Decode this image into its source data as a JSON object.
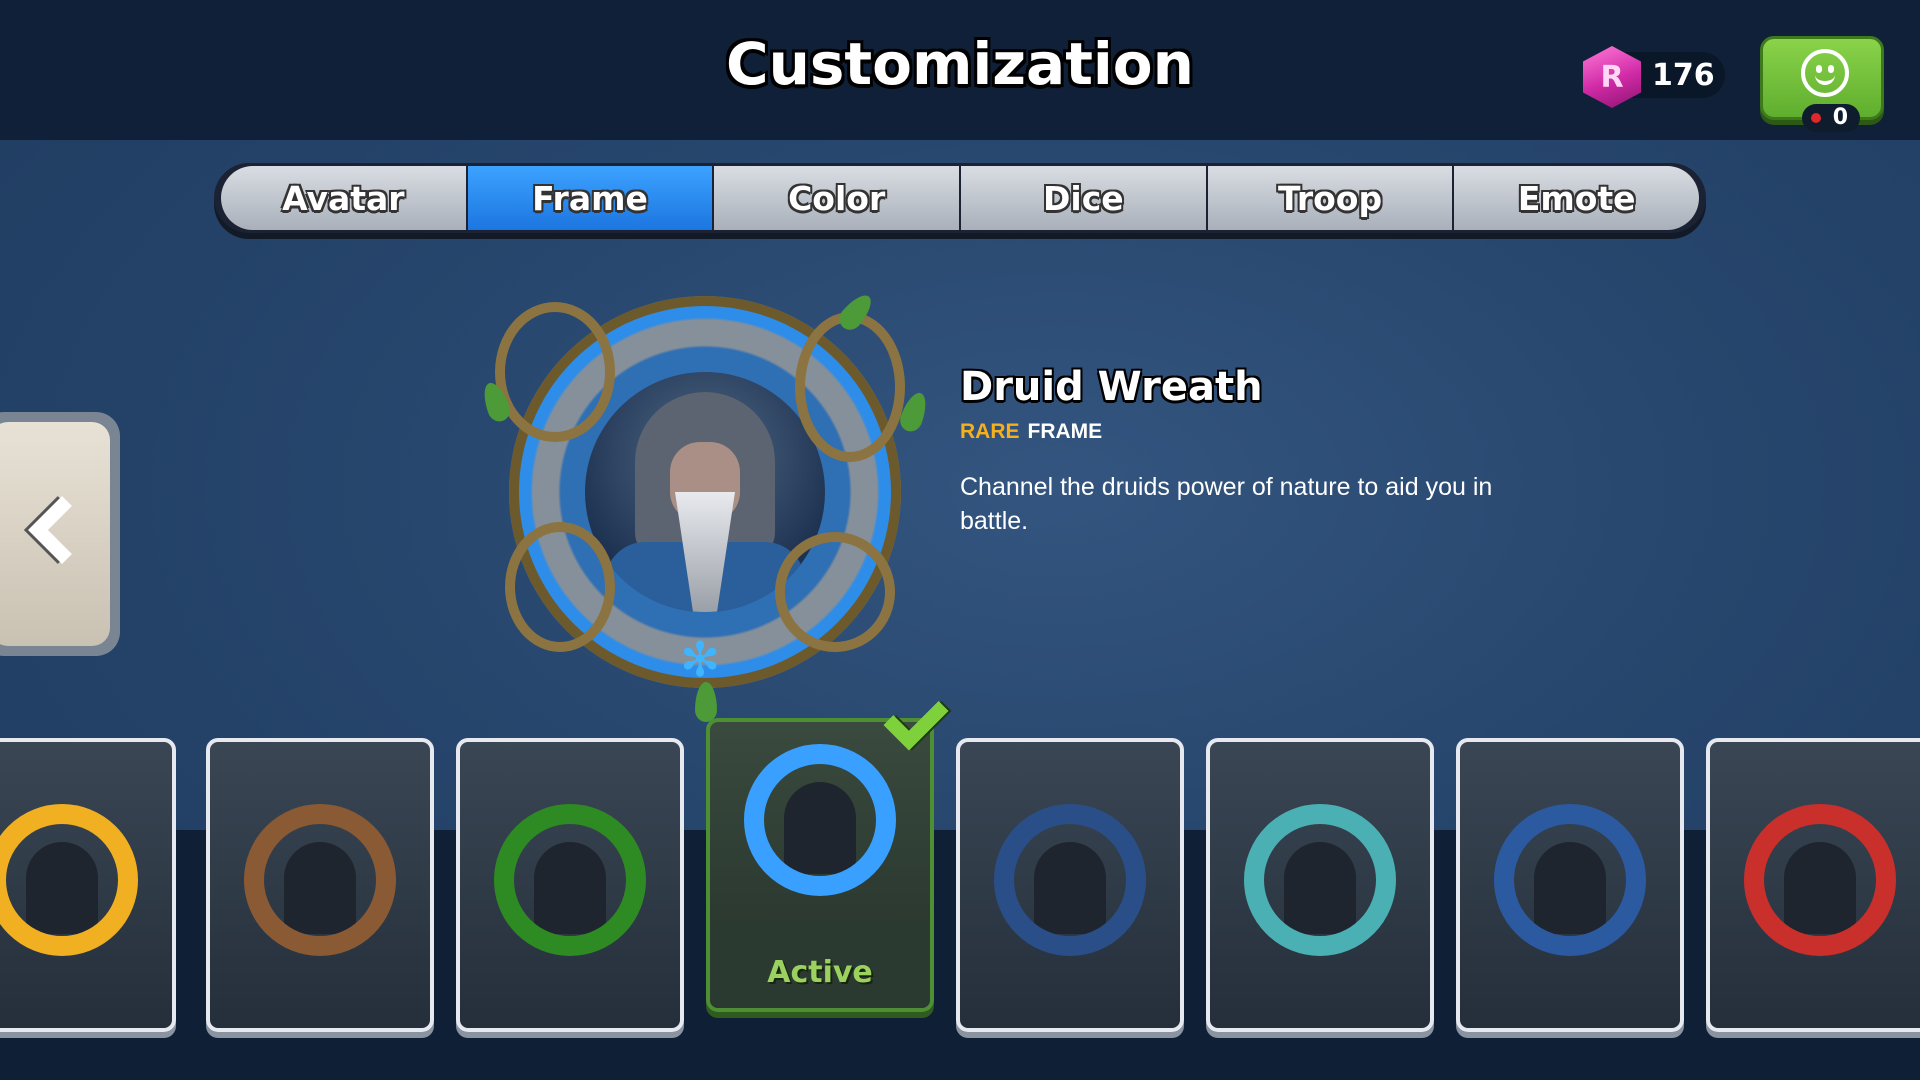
{
  "header": {
    "title": "Customization",
    "currency_icon": "R",
    "currency_count": "176",
    "emote_count": "0"
  },
  "tabs": [
    {
      "label": "Avatar",
      "active": false
    },
    {
      "label": "Frame",
      "active": true
    },
    {
      "label": "Color",
      "active": false
    },
    {
      "label": "Dice",
      "active": false
    },
    {
      "label": "Troop",
      "active": false
    },
    {
      "label": "Emote",
      "active": false
    }
  ],
  "detail": {
    "name": "Druid Wreath",
    "rarity": "RARE",
    "type": "FRAME",
    "description": "Channel the druids power of nature to aid you in battle."
  },
  "frames": [
    {
      "name": "gold-laurel-frame",
      "ring_color": "#f0b021"
    },
    {
      "name": "silver-horn-frame",
      "ring_color": "#8a5a35"
    },
    {
      "name": "green-star-frame",
      "ring_color": "#2e8a22"
    },
    {
      "name": "druid-wreath-frame",
      "ring_color": "#3aa0ff",
      "active": true,
      "label": "Active"
    },
    {
      "name": "all-seeing-eye-frame",
      "ring_color": "#2a4f88"
    },
    {
      "name": "zombie-frame",
      "ring_color": "#4bb0b4"
    },
    {
      "name": "spiked-gem-frame",
      "ring_color": "#2c5aa0"
    },
    {
      "name": "oni-mask-frame",
      "ring_color": "#c9302c"
    }
  ],
  "colors": {
    "accent_tab": "#1c76e0",
    "rarity_rare": "#f6b01b",
    "active_green": "#9bd15f"
  }
}
